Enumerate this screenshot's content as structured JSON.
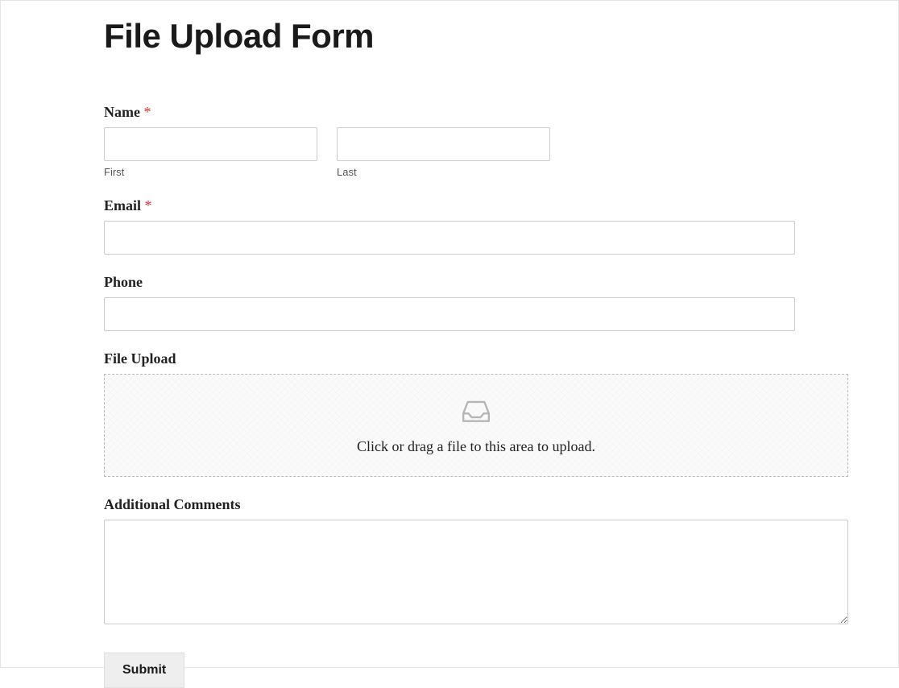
{
  "header": {
    "title": "File Upload Form"
  },
  "fields": {
    "name": {
      "label": "Name",
      "required_marker": "*",
      "first_sublabel": "First",
      "last_sublabel": "Last",
      "first_value": "",
      "last_value": ""
    },
    "email": {
      "label": "Email",
      "required_marker": "*",
      "value": ""
    },
    "phone": {
      "label": "Phone",
      "value": ""
    },
    "file_upload": {
      "label": "File Upload",
      "dropzone_text": "Click or drag a file to this area to upload."
    },
    "comments": {
      "label": "Additional Comments",
      "value": ""
    }
  },
  "buttons": {
    "submit_label": "Submit"
  }
}
